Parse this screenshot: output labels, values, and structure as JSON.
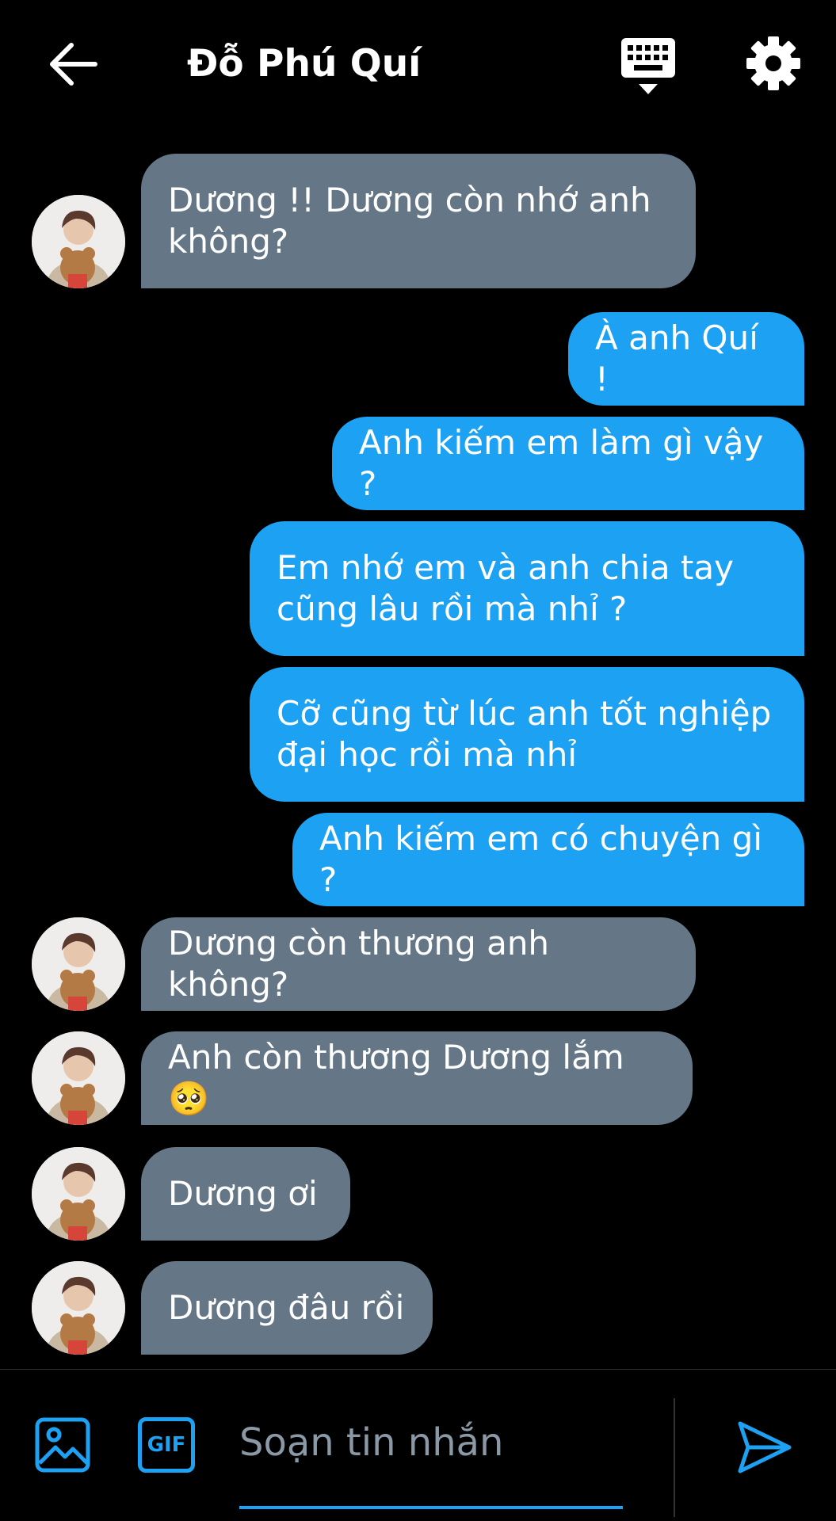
{
  "header": {
    "title": "Đỗ Phú Quí"
  },
  "icons": {
    "back": "arrow-left-icon",
    "keyboard": "keyboard-icon",
    "settings": "gear-icon",
    "image": "image-icon",
    "send": "send-icon"
  },
  "colors": {
    "incoming": "#657786",
    "outgoing": "#1da1f2",
    "background": "#000000"
  },
  "messages": [
    {
      "from": "them",
      "text": "Dương !! Dương còn nhớ anh\nkhông?"
    },
    {
      "from": "me",
      "text": "À anh Quí !"
    },
    {
      "from": "me",
      "text": "Anh kiếm em làm gì vậy ?"
    },
    {
      "from": "me",
      "text": "Em nhớ em và anh chia tay\ncũng lâu rồi mà nhỉ ?"
    },
    {
      "from": "me",
      "text": "Cỡ cũng từ lúc anh tốt nghiệp\nđại học rồi mà nhỉ"
    },
    {
      "from": "me",
      "text": "Anh kiếm em có chuyện gì ?"
    },
    {
      "from": "them",
      "text": "Dương còn thương anh không?"
    },
    {
      "from": "them",
      "text": "Anh còn thương Dương lắm 🥺"
    },
    {
      "from": "them",
      "text": "Dương ơi"
    },
    {
      "from": "them",
      "text": "Dương đâu rồi"
    }
  ],
  "composer": {
    "gif_label": "GIF",
    "placeholder": "Soạn tin nhắn"
  }
}
